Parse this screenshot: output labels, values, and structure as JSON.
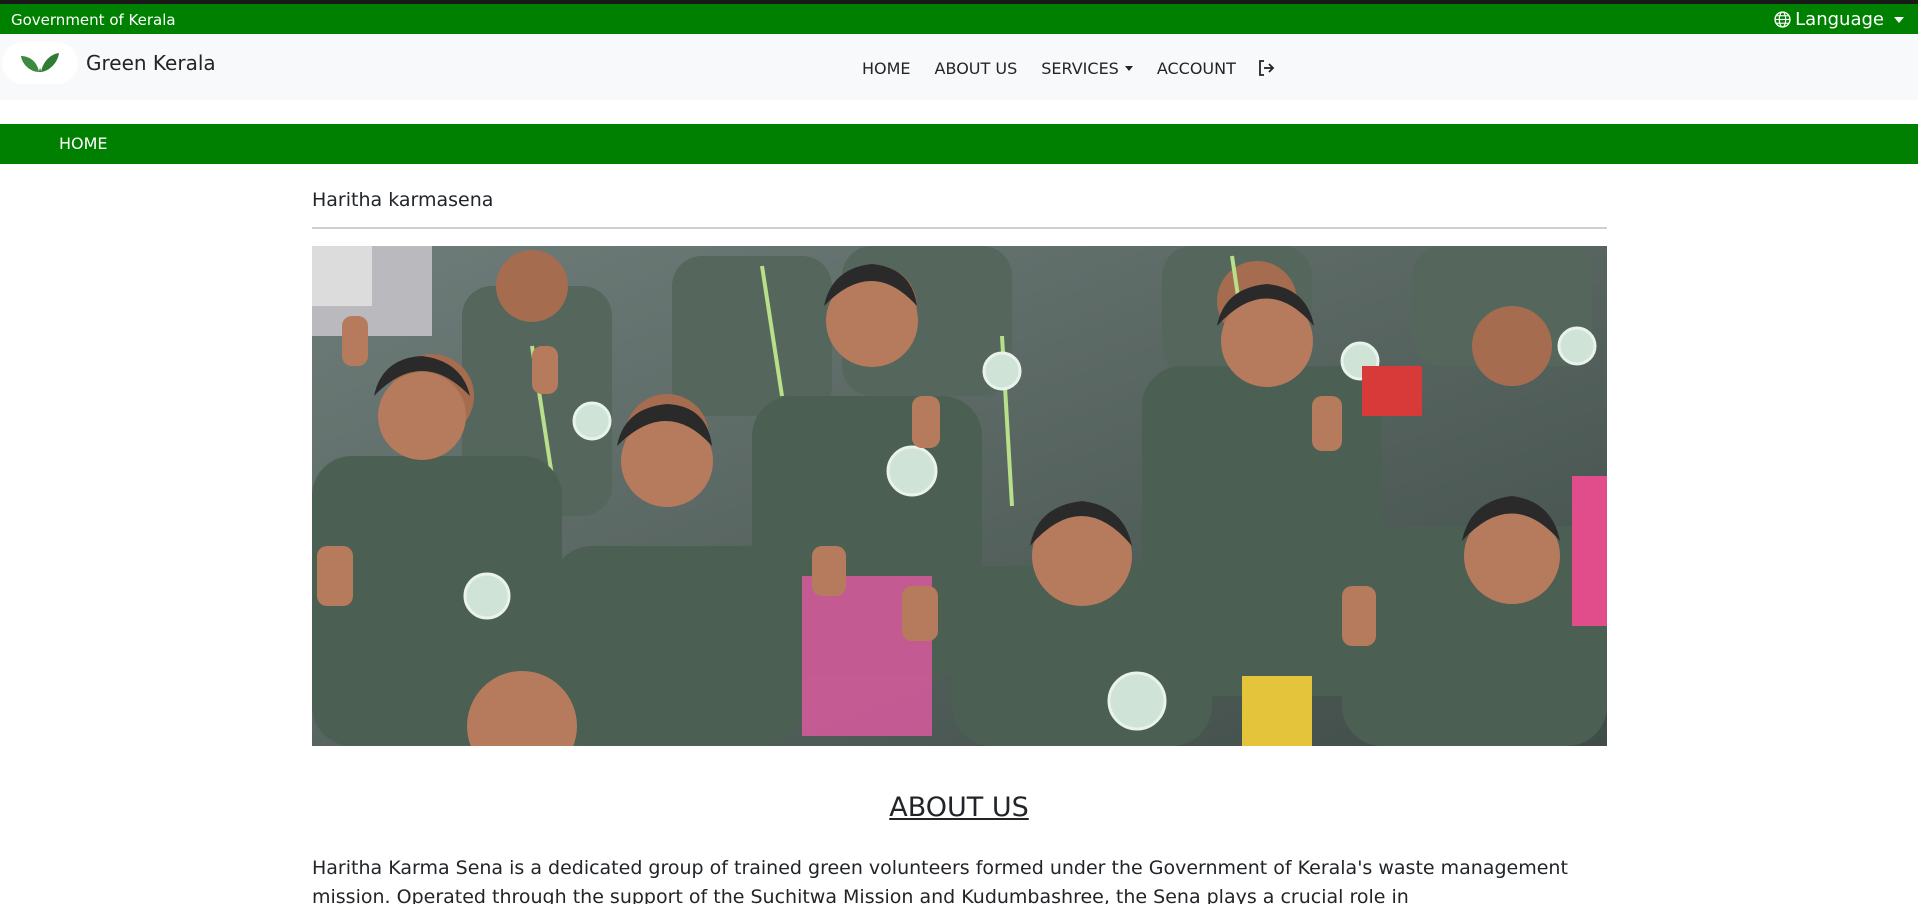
{
  "gov_bar": {
    "label": "Government of Kerala",
    "language_label": "Language",
    "icon": "globe-icon"
  },
  "navbar": {
    "brand_name": "Green Kerala",
    "brand_icon": "leaf-logo-icon",
    "items": [
      {
        "label": "HOME"
      },
      {
        "label": "ABOUT US"
      },
      {
        "label": "SERVICES"
      },
      {
        "label": "ACCOUNT"
      }
    ],
    "logout_icon": "logout-icon"
  },
  "breadcrumb": {
    "label": "HOME"
  },
  "main": {
    "title": "Haritha karmasena",
    "hero_alt": "Haritha Karma Sena volunteers giving thumbs up",
    "about_heading": "ABOUT US",
    "about_text": "Haritha Karma Sena is a dedicated group of trained green volunteers formed under the Government of Kerala's waste management mission. Operated through the support of the Suchitwa Mission and Kudumbashree, the Sena plays a crucial role in"
  },
  "colors": {
    "primary_green": "#008000",
    "navbar_bg": "#f8f9fa",
    "uniform_green": "#4b5f53"
  }
}
